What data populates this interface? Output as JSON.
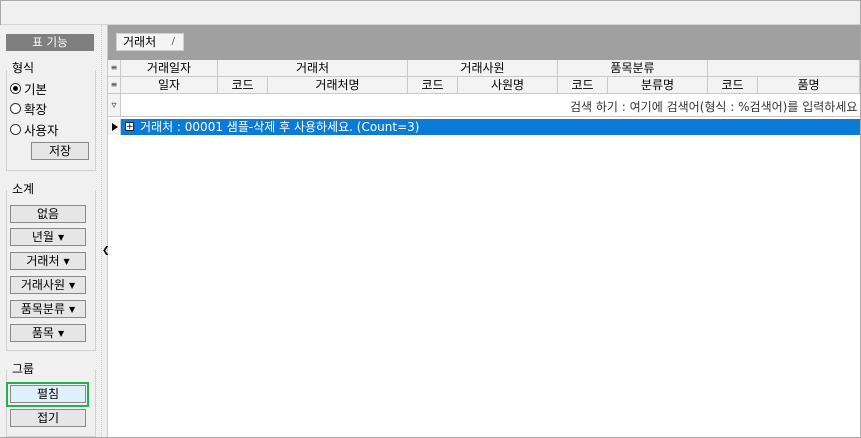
{
  "panel": {
    "title": "표 기능",
    "format_group": {
      "label": "형식",
      "options": [
        {
          "label": "기본",
          "selected": true
        },
        {
          "label": "확장",
          "selected": false
        },
        {
          "label": "사용자",
          "selected": false
        }
      ],
      "save_label": "저장"
    },
    "subtotal_group": {
      "label": "소계",
      "buttons": [
        "없음",
        "년월",
        "거래처",
        "거래사원",
        "품목분류",
        "품목"
      ]
    },
    "group_group": {
      "label": "그룹",
      "expand_label": "펼침",
      "collapse_label": "접기"
    }
  },
  "tab": {
    "label": "거래처",
    "close": "/"
  },
  "header_top": [
    "거래일자",
    "거래처",
    "거래사원",
    "품목분류",
    ""
  ],
  "header_sub": [
    "일자",
    "코드",
    "거래처명",
    "코드",
    "사원명",
    "코드",
    "분류명",
    "코드",
    "품명"
  ],
  "search_hint": "검색 하기 : 여기에 검색어(형식 : %검색어)를 입력하세요",
  "group_row": {
    "expander": "+",
    "text": "거래처 : 00001 샘플-삭제 후 사용하세요. (Count=3)"
  },
  "colors": {
    "selection": "#0a7bd6",
    "highlight_border": "#22b14c"
  }
}
